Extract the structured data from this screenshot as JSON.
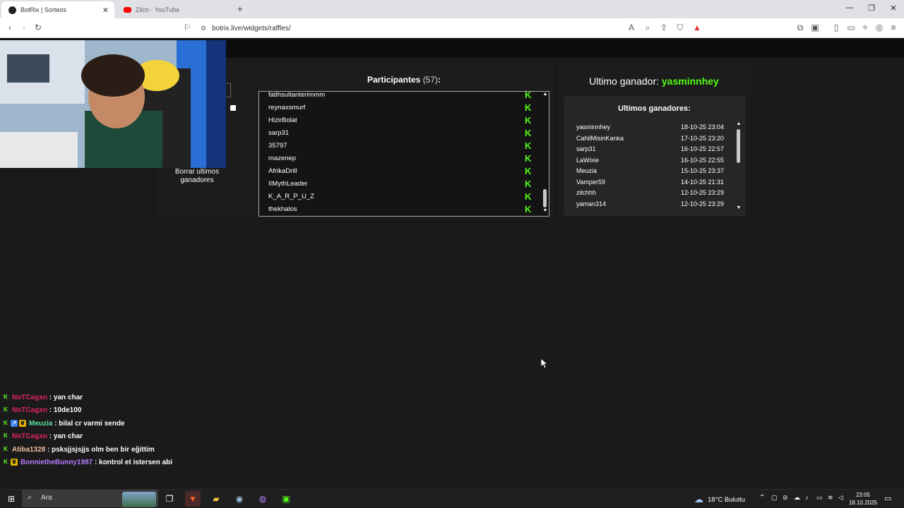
{
  "browser": {
    "tabs": [
      {
        "label": "BotRix | Sorteos",
        "active": true
      },
      {
        "label": "Zilch - YouTube",
        "active": false
      }
    ],
    "new_tab_glyph": "+",
    "close_glyph": "✕",
    "url": "botrix.live/widgets/raffles/",
    "window_controls": [
      "—",
      "❐",
      "✕"
    ]
  },
  "raffle": {
    "left_panel": {
      "clear_winners_label": "Borrar ultimos ganadores"
    },
    "participants": {
      "title": "Participantes",
      "count": "(57)",
      "suffix": ":",
      "items": [
        "fatihsultanterimmm",
        "reynaxsmurf",
        "HizirBolat",
        "sarp31",
        "35797",
        "mazenep",
        "AfrikaDrill",
        "IIMythLeader",
        "K_A_R_P_U_Z",
        "thekhalos"
      ]
    },
    "last_winner": {
      "label": "Ultimo ganador:",
      "name": "yasminnhey"
    },
    "recent_winners": {
      "title": "Ultimos ganadores:",
      "items": [
        {
          "name": "yasminnhey",
          "date": "18-10-25 23:04"
        },
        {
          "name": "CahilMisinKanka",
          "date": "17-10-25 23:20"
        },
        {
          "name": "sarp31",
          "date": "16-10-25 22:57"
        },
        {
          "name": "LaWixie",
          "date": "16-10-25 22:55"
        },
        {
          "name": "Meuzia",
          "date": "15-10-25 23:37"
        },
        {
          "name": "Vamper59",
          "date": "14-10-25 21:31"
        },
        {
          "name": "zilchhh",
          "date": "12-10-25 23:29"
        },
        {
          "name": "yaman314",
          "date": "12-10-25 23:29"
        }
      ]
    },
    "colors": {
      "kick_green": "#53fc18",
      "panel": "#1c1c1c"
    }
  },
  "chat": [
    {
      "user": "NoTCagxn",
      "color": "#e0245e",
      "badges": [
        "kick"
      ],
      "message": ": yan char"
    },
    {
      "user": "NoTCagxn",
      "color": "#e0245e",
      "badges": [
        "kick"
      ],
      "message": ": 10de100"
    },
    {
      "user": "Meuzia",
      "color": "#5ee0a0",
      "badges": [
        "kick",
        "blue",
        "gold"
      ],
      "message": ": bilal cr varmi sende"
    },
    {
      "user": "NoTCagxn",
      "color": "#e0245e",
      "badges": [
        "kick"
      ],
      "message": ": yan char"
    },
    {
      "user": "Atiba1328",
      "color": "#f0c0a0",
      "badges": [
        "kick"
      ],
      "message": ": psksjjsjsjjs olm ben bir eğittim"
    },
    {
      "user": "BonnietheBunny1987",
      "color": "#b57cff",
      "badges": [
        "kick",
        "gold"
      ],
      "message": ": kontrol et istersen abi"
    }
  ],
  "taskbar": {
    "search_placeholder": "Ara",
    "weather": "18°C Bulutlu",
    "time": "23:05",
    "date": "18.10.2025"
  }
}
